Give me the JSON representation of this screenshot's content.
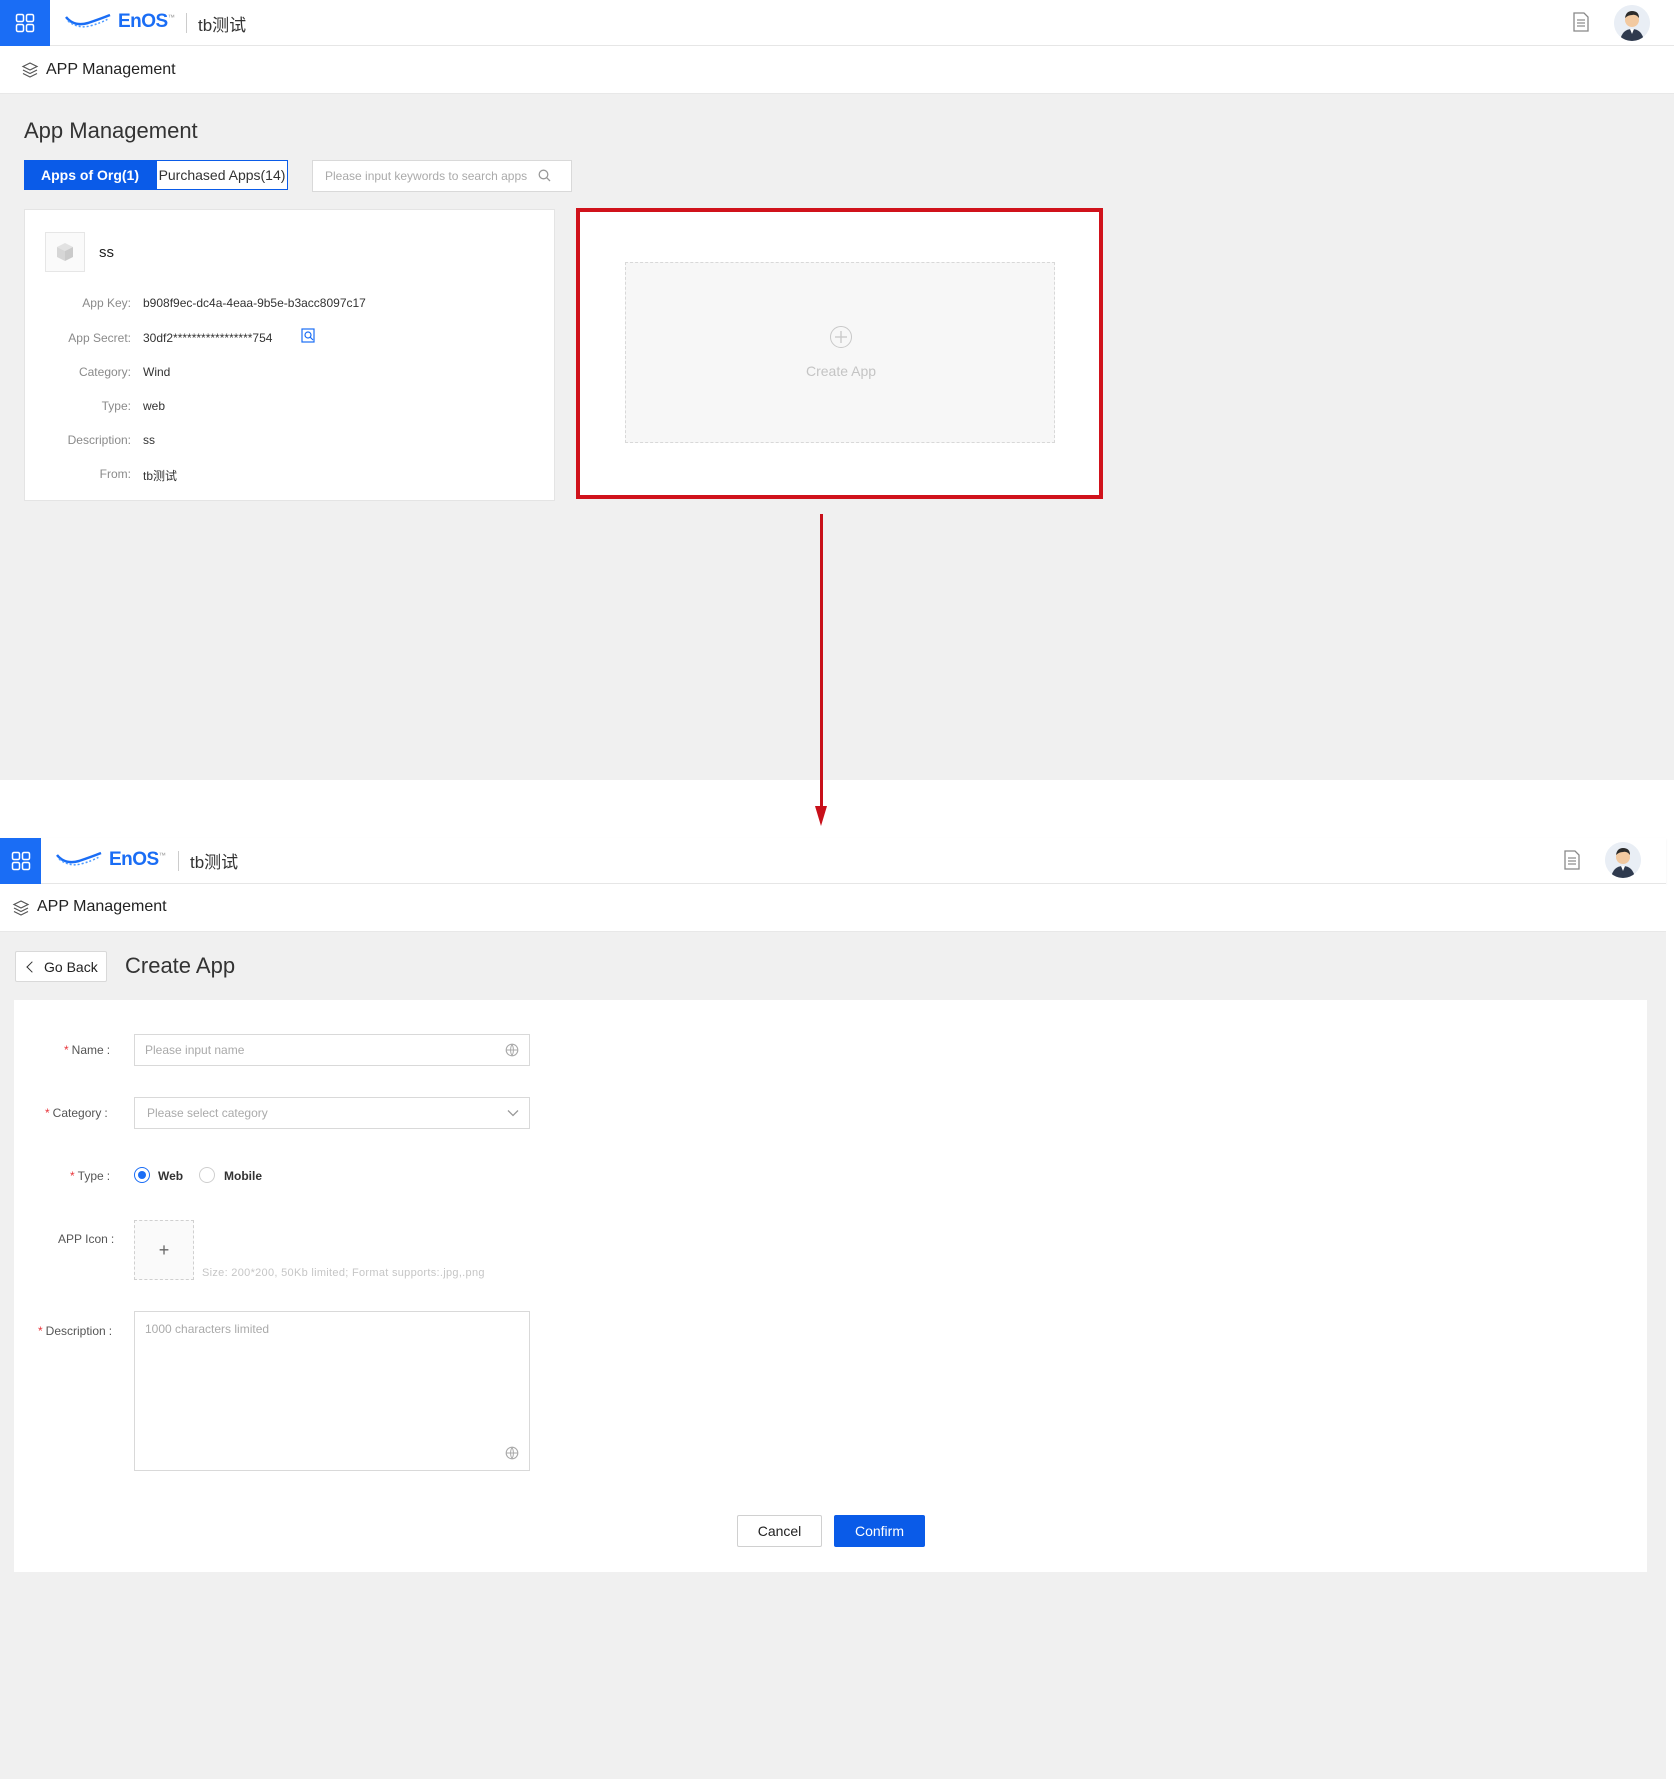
{
  "brand": {
    "logo_text": "EnOS",
    "trademark": "™",
    "org_name": "tb测试",
    "accent_color": "#1a6df5",
    "annotation_color": "#d0121b"
  },
  "screen1": {
    "section_title": "APP Management",
    "page_title": "App Management",
    "tabs": [
      {
        "label": "Apps of Org(1)",
        "active": true
      },
      {
        "label": "Purchased Apps(14)",
        "active": false
      }
    ],
    "search": {
      "placeholder": "Please input keywords to search apps"
    },
    "app_card": {
      "name": "ss",
      "fields": [
        {
          "key": "App Key:",
          "value": "b908f9ec-dc4a-4eaa-9b5e-b3acc8097c17"
        },
        {
          "key": "App Secret:",
          "value": "30df2*****************754"
        },
        {
          "key": "Category:",
          "value": "Wind"
        },
        {
          "key": "Type:",
          "value": "web"
        },
        {
          "key": "Description:",
          "value": "ss"
        },
        {
          "key": "From:",
          "value": "tb测试"
        }
      ]
    },
    "create_card": {
      "label": "Create App"
    }
  },
  "screen2": {
    "section_title": "APP Management",
    "go_back_label": "Go Back",
    "page_title": "Create App",
    "form": {
      "name_label": "Name",
      "name_placeholder": "Please input name",
      "category_label": "Category",
      "category_placeholder": "Please select category",
      "type_label": "Type",
      "type_options": [
        {
          "label": "Web",
          "selected": true
        },
        {
          "label": "Mobile",
          "selected": false
        }
      ],
      "icon_label": "APP Icon",
      "upload_symbol": "+",
      "upload_hint": "Size: 200*200, 50Kb limited; Format supports:.jpg,.png",
      "description_label": "Description",
      "description_placeholder": "1000 characters limited",
      "colon": ":"
    },
    "buttons": {
      "cancel": "Cancel",
      "confirm": "Confirm"
    }
  }
}
